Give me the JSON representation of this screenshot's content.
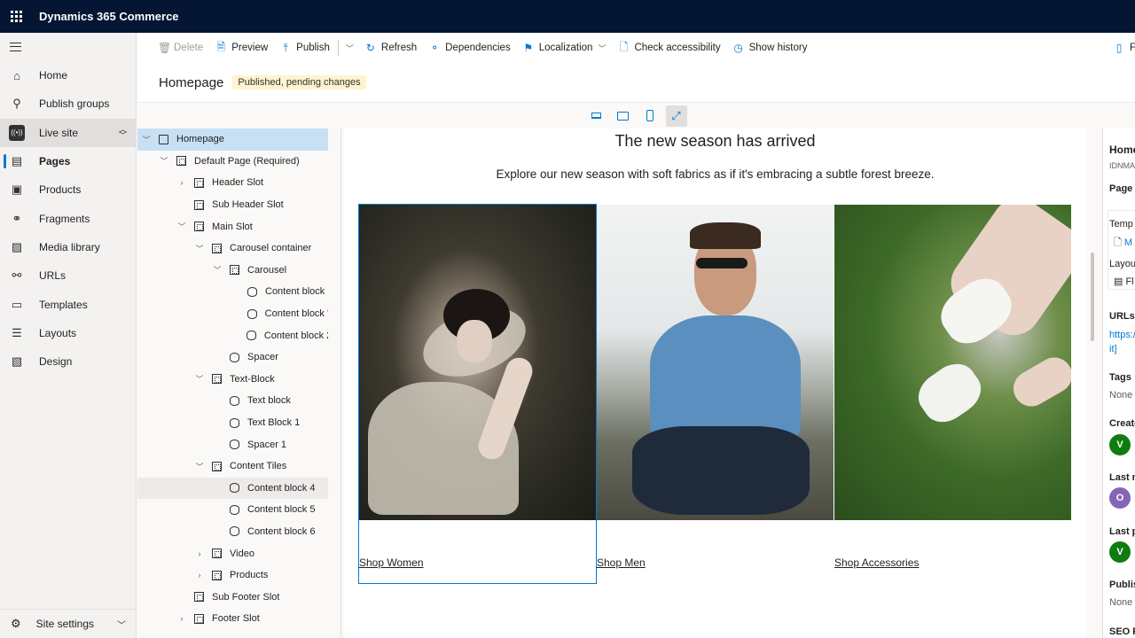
{
  "app": {
    "title": "Dynamics 365 Commerce"
  },
  "nav": {
    "items": [
      {
        "label": "Home",
        "icon": "home-icon"
      },
      {
        "label": "Publish groups",
        "icon": "publish-groups-icon"
      },
      {
        "label": "Live site",
        "icon": "live-site-icon"
      },
      {
        "label": "Pages",
        "icon": "pages-icon",
        "active": true
      },
      {
        "label": "Products",
        "icon": "products-icon"
      },
      {
        "label": "Fragments",
        "icon": "fragments-icon"
      },
      {
        "label": "Media library",
        "icon": "media-library-icon"
      },
      {
        "label": "URLs",
        "icon": "urls-icon"
      },
      {
        "label": "Templates",
        "icon": "templates-icon"
      },
      {
        "label": "Layouts",
        "icon": "layouts-icon"
      },
      {
        "label": "Design",
        "icon": "design-icon"
      }
    ],
    "site_settings": "Site settings"
  },
  "commands": {
    "delete": "Delete",
    "preview": "Preview",
    "publish": "Publish",
    "refresh": "Refresh",
    "dependencies": "Dependencies",
    "localization": "Localization",
    "check_accessibility": "Check accessibility",
    "show_history": "Show history",
    "favorite": "Fa"
  },
  "page": {
    "title": "Homepage",
    "status": "Published, pending changes"
  },
  "tree": {
    "nodes": [
      {
        "label": "Homepage"
      },
      {
        "label": "Default Page (Required)"
      },
      {
        "label": "Header Slot"
      },
      {
        "label": "Sub Header Slot"
      },
      {
        "label": "Main Slot"
      },
      {
        "label": "Carousel container"
      },
      {
        "label": "Carousel"
      },
      {
        "label": "Content block"
      },
      {
        "label": "Content block '"
      },
      {
        "label": "Content block 2"
      },
      {
        "label": "Spacer"
      },
      {
        "label": "Text-Block"
      },
      {
        "label": "Text block"
      },
      {
        "label": "Text Block 1"
      },
      {
        "label": "Spacer 1"
      },
      {
        "label": "Content Tiles"
      },
      {
        "label": "Content block 4"
      },
      {
        "label": "Content block 5"
      },
      {
        "label": "Content block 6"
      },
      {
        "label": "Video"
      },
      {
        "label": "Products"
      },
      {
        "label": "Sub Footer Slot"
      },
      {
        "label": "Footer Slot"
      }
    ]
  },
  "canvas": {
    "headline": "The new season has arrived",
    "subheadline": "Explore our new season with soft fabrics as if it's embracing a subtle forest breeze.",
    "tiles": [
      {
        "link": "Shop Women"
      },
      {
        "link": "Shop Men"
      },
      {
        "link": "Shop Accessories"
      }
    ]
  },
  "properties": {
    "title": "Home",
    "id": "IDNMA",
    "section_page": "Page a",
    "template_label": "Temp",
    "template_value": "M",
    "layout_label": "Layou",
    "layout_value": "Fl",
    "urls_label": "URLs",
    "url_value_1": "https:/",
    "url_value_2": "it]",
    "tags_label": "Tags",
    "tags_value": "None",
    "created_label": "Create",
    "created_avatar": "V",
    "last_modified_label": "Last m",
    "last_modified_avatar": "O",
    "last_published_label": "Last p",
    "last_published_avatar": "V",
    "published_label": "Publis",
    "published_value": "None",
    "seo_label": "SEO P"
  },
  "colors": {
    "topbar": "#041634",
    "accent": "#0078d4",
    "status_badge": "#fff4ce",
    "avatar_green": "#107c10",
    "avatar_purple": "#8764b8"
  }
}
